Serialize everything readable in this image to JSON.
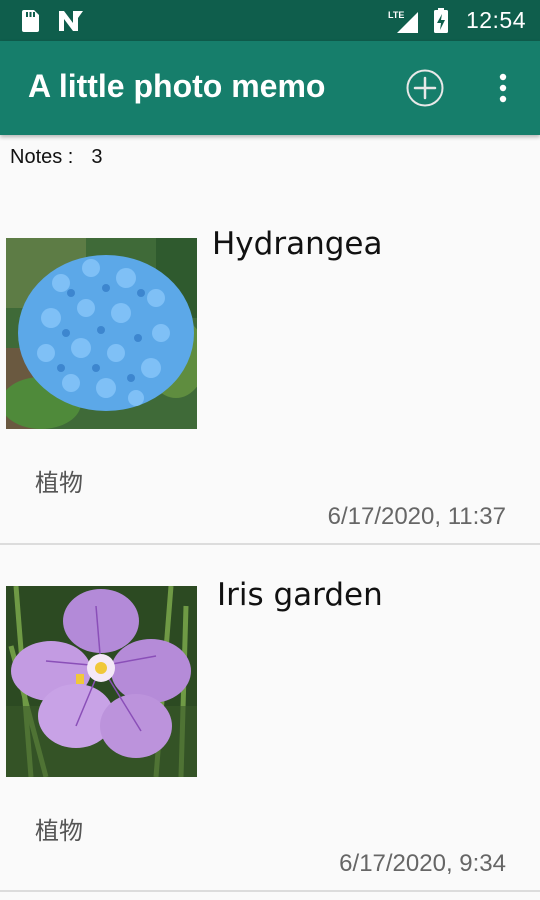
{
  "status_bar": {
    "time": "12:54",
    "icons": [
      "sd-card-icon",
      "n-notification-icon",
      "lte-signal-icon",
      "battery-charging-icon"
    ],
    "signal_label": "LTE"
  },
  "app_bar": {
    "title": "A little photo memo",
    "actions": [
      "add-circle-icon",
      "more-vert-icon"
    ],
    "color": "#167e6b",
    "status_color": "#0f5e4c"
  },
  "notes": {
    "label": "Notes :",
    "count": "3"
  },
  "memos": [
    {
      "title": "Hydrangea",
      "tag": "植物",
      "date": "6/17/2020, 11:37",
      "image": "hydrangea-photo"
    },
    {
      "title": "Iris garden",
      "tag": "植物",
      "date": "6/17/2020, 9:34",
      "image": "iris-photo"
    }
  ]
}
